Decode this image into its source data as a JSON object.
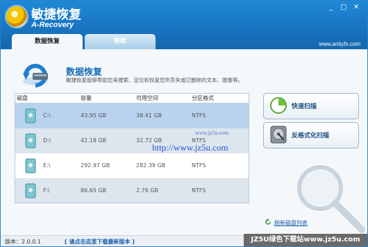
{
  "app": {
    "name": "敏捷恢复",
    "subtitle": "A-Recovery",
    "url": "www.antiyfx.com"
  },
  "window_controls": [
    "_",
    "▢",
    "✕"
  ],
  "tabs": [
    {
      "label": "数据恢复",
      "active": true
    },
    {
      "label": "帮助",
      "active": false
    }
  ],
  "header": {
    "title": "数据恢复",
    "description": "敏捷恢复能够帮助您来搜索、定位和恢复您所丢失或已删除的文本、图像等。"
  },
  "table": {
    "columns": [
      "磁盘",
      "容量",
      "可用空间",
      "分区格式"
    ],
    "rows": [
      {
        "disk": "C:\\",
        "capacity": "43.95 GB",
        "free": "38.41 GB",
        "fs": "NTFS"
      },
      {
        "disk": "D:\\",
        "capacity": "42.18 GB",
        "free": "32.72 GB",
        "fs": "NTFS"
      },
      {
        "disk": "E:\\",
        "capacity": "292.97 GB",
        "free": "282.39 GB",
        "fs": "NTFS"
      },
      {
        "disk": "F:\\",
        "capacity": "86.65 GB",
        "free": "2.76 GB",
        "fs": "NTFS"
      }
    ]
  },
  "actions": {
    "quick_scan": "快速扫描",
    "format_scan": "反格式化扫描",
    "refresh": "刷新磁盘列表"
  },
  "status": {
    "version": "版本：2.0.0.1",
    "update": "[ 请点击这里下载最新版本 ]"
  },
  "overlays": {
    "watermark": "http://www.jz5u.com",
    "watermark_small": "www.jz5u.com",
    "banner": "JZ5U绿色下载站www.jz5u.com"
  }
}
